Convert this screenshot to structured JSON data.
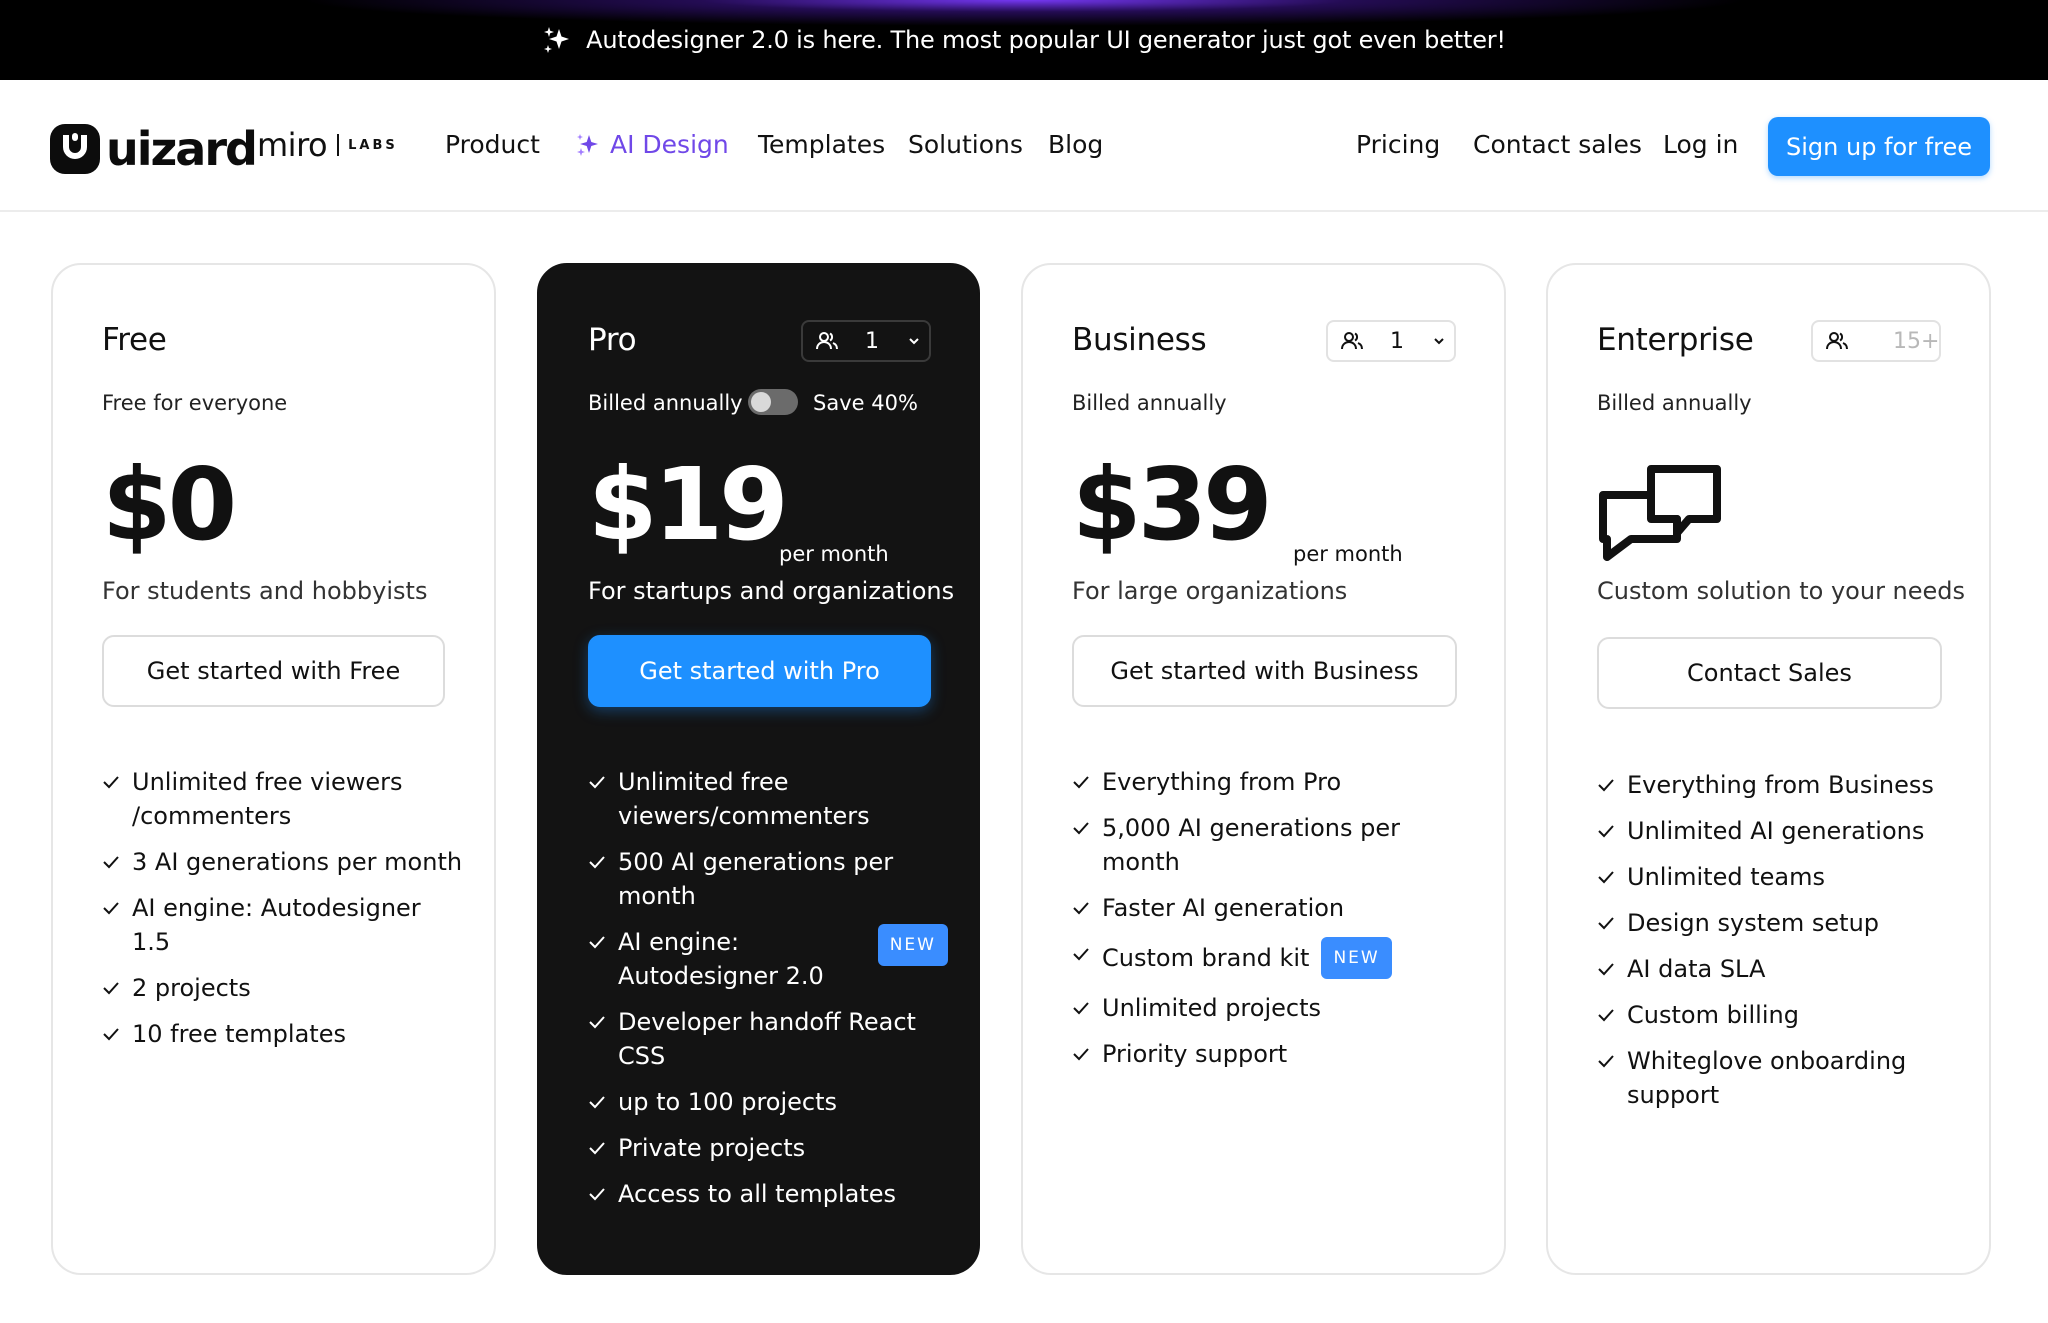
{
  "announcement": {
    "text": "Autodesigner 2.0 is here. The most popular UI generator just got even better!",
    "icon": "sparkle-icon"
  },
  "brand": {
    "logo_text": "uizard",
    "partner": "miro",
    "partner_suffix": "LABS"
  },
  "nav": {
    "links": [
      "Product",
      "AI Design",
      "Templates",
      "Solutions",
      "Blog"
    ],
    "right_links": [
      "Pricing",
      "Contact sales",
      "Log in"
    ],
    "signup_label": "Sign up for free"
  },
  "colors": {
    "accent": "#1e90ff",
    "ai_purple": "#7048e8",
    "dark_card": "#131313",
    "badge": "#3a8dff"
  },
  "plans": [
    {
      "name": "Free",
      "billing": "Free for everyone",
      "price": "$0",
      "tagline": "For students and hobbyists",
      "cta": "Get started with Free",
      "features": [
        "Unlimited free viewers /commenters",
        "3 AI generations per month",
        "AI engine: Autodesigner 1.5",
        "2 projects",
        "10 free templates"
      ]
    },
    {
      "name": "Pro",
      "seats": "1",
      "billing": "Billed annually",
      "toggle_on": false,
      "save_text": "Save 40%",
      "price": "$19",
      "per": "per month",
      "tagline": "For startups and organizations",
      "cta": "Get started with Pro",
      "features": [
        "Unlimited free viewers/commenters",
        "500 AI generations per month",
        "AI engine: Autodesigner 2.0",
        "Developer handoff React CSS",
        "up to 100 projects",
        "Private projects",
        "Access to all templates"
      ],
      "badge": "NEW"
    },
    {
      "name": "Business",
      "seats": "1",
      "billing": "Billed annually",
      "price": "$39",
      "per": "per month",
      "tagline": "For large organizations",
      "cta": "Get started with Business",
      "features": [
        "Everything from Pro",
        "5,000 AI generations per month",
        "Faster AI generation",
        "Custom brand kit",
        "Unlimited projects",
        "Priority support"
      ],
      "badge": "NEW"
    },
    {
      "name": "Enterprise",
      "seats": "15+",
      "billing": "Billed annually",
      "tagline": "Custom solution to your needs",
      "cta": "Contact Sales",
      "features": [
        "Everything from Business",
        "Unlimited AI generations",
        "Unlimited teams",
        "Design system setup",
        "AI data SLA",
        "Custom billing",
        "Whiteglove onboarding support"
      ]
    }
  ]
}
